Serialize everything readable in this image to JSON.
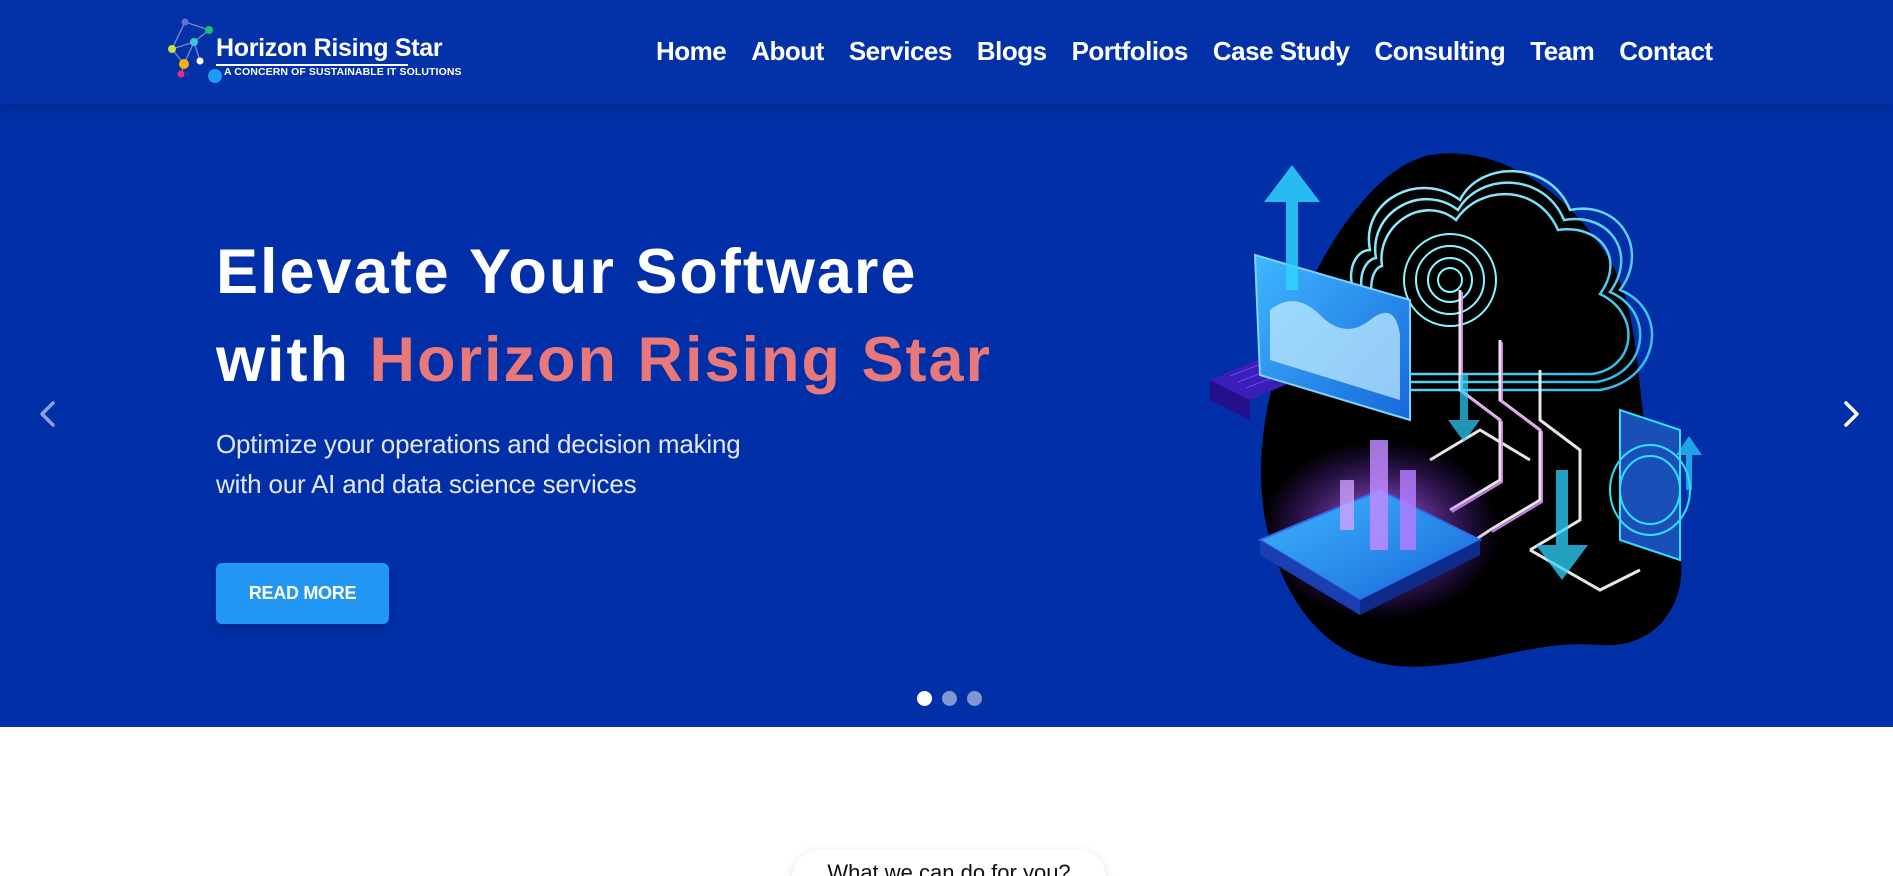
{
  "brand": {
    "name": "Horizon Rising Star",
    "tagline": "A CONCERN OF SUSTAINABLE IT SOLUTIONS"
  },
  "nav": {
    "items": [
      {
        "label": "Home"
      },
      {
        "label": "About"
      },
      {
        "label": "Services"
      },
      {
        "label": "Blogs"
      },
      {
        "label": "Portfolios"
      },
      {
        "label": "Case Study"
      },
      {
        "label": "Consulting"
      },
      {
        "label": "Team"
      },
      {
        "label": "Contact"
      }
    ]
  },
  "hero": {
    "title_line1": "Elevate Your Software",
    "title_line2_prefix": "with ",
    "title_line2_accent": "Horizon Rising Star",
    "subtitle_line1": "Optimize your operations and decision making",
    "subtitle_line2": "with our AI and data science services",
    "cta_label": "READ MORE",
    "slides_count": 3,
    "active_slide": 1,
    "prev_icon": "chevron-left-icon",
    "next_icon": "chevron-right-icon"
  },
  "section": {
    "pill_label": "What we can do for you?"
  },
  "colors": {
    "header_bg": "#0231a8",
    "hero_bg": "#002fa7",
    "accent_text": "#e8787a",
    "cta_bg": "#2196f3",
    "text_light": "#ffffff"
  }
}
